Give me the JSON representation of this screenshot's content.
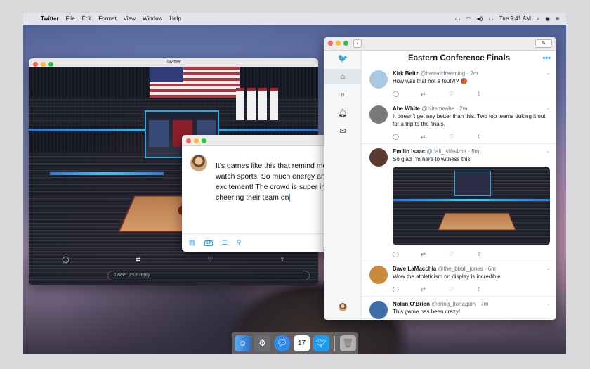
{
  "menubar": {
    "app_name": "Twitter",
    "items": [
      "File",
      "Edit",
      "Format",
      "View",
      "Window",
      "Help"
    ],
    "clock": "Tue 9:41 AM"
  },
  "media_window": {
    "title": "Twitter",
    "reply_placeholder": "Tweet your reply"
  },
  "compose": {
    "text": "It's games like this that remind me why I watch sports. So much energy and excitement! The crowd is super into it and cheering their team on",
    "gif_label": "GIF"
  },
  "timeline": {
    "title": "Eastern Conference Finals",
    "more": "•••",
    "tweets": [
      {
        "name": "Kirk Beitz",
        "handle": "@hawaiidreaming",
        "time": "· 2m",
        "text": "How was that not a foul?!?",
        "avatar_color": "#a9c9e3"
      },
      {
        "name": "Abe White",
        "handle": "@hiitsmeabe",
        "time": "· 2m",
        "text": "It doesn't get any better than this. Two top teams duking it out for a trip to the finals.",
        "avatar_color": "#7a7a7a"
      },
      {
        "name": "Emilio Isaac",
        "handle": "@ball_islife4me",
        "time": "· 5m",
        "text": "So glad I'm here to witness this!",
        "avatar_color": "#5a3b2e"
      },
      {
        "name": "Dave LaMacchia",
        "handle": "@the_bball_jones",
        "time": "· 6m",
        "text": "Wow the athleticism on display is incredible",
        "avatar_color": "#c98a3b"
      },
      {
        "name": "Nolan O'Brien",
        "handle": "@bring_itonagain",
        "time": "· 7m",
        "text": "This game has been crazy!",
        "avatar_color": "#3f6fa6"
      }
    ]
  },
  "dock": {
    "calendar_day": "17"
  },
  "colors": {
    "twitter_blue": "#1d9bf0",
    "raptors_red": "#b0262f"
  }
}
